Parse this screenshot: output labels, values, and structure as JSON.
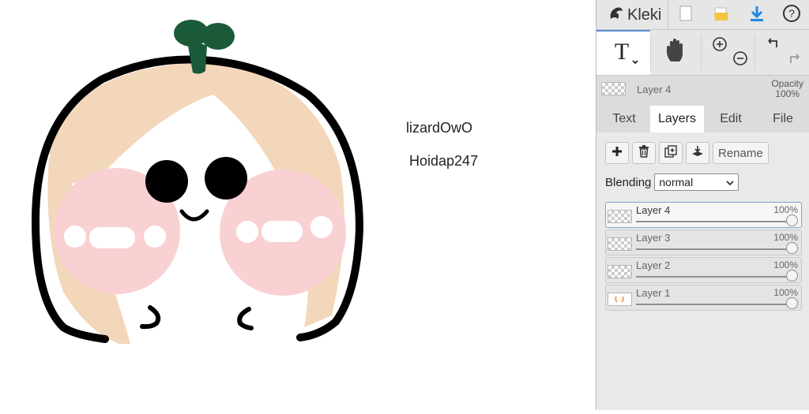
{
  "canvas": {
    "texts": [
      "lizardOwO",
      "Hoidap247"
    ]
  },
  "app": {
    "name": "Kleki"
  },
  "current_layer": {
    "name": "Layer 4",
    "opacity_label": "Opacity",
    "opacity_value": "100%"
  },
  "tabs": [
    {
      "label": "Text",
      "active": false
    },
    {
      "label": "Layers",
      "active": true
    },
    {
      "label": "Edit",
      "active": false
    },
    {
      "label": "File",
      "active": false
    }
  ],
  "layer_panel": {
    "rename_label": "Rename",
    "blending_label": "Blending",
    "blending_value": "normal",
    "layers": [
      {
        "name": "Layer 4",
        "opacity": "100%",
        "selected": true
      },
      {
        "name": "Layer 3",
        "opacity": "100%",
        "selected": false
      },
      {
        "name": "Layer 2",
        "opacity": "100%",
        "selected": false
      },
      {
        "name": "Layer 1",
        "opacity": "100%",
        "selected": false
      }
    ]
  },
  "icons": {
    "topbar": [
      "kleki-logo-icon",
      "new-image-icon",
      "open-folder-icon",
      "download-icon",
      "help-icon"
    ],
    "tools": [
      "text-tool-icon",
      "hand-tool-icon",
      "zoom-in-icon",
      "zoom-out-icon",
      "undo-icon",
      "redo-icon"
    ],
    "layer_buttons": [
      "add-layer-icon",
      "delete-layer-icon",
      "duplicate-layer-icon",
      "merge-layer-icon"
    ]
  },
  "colors": {
    "accent": "#5b8fd6",
    "download": "#1e88e5",
    "folder": "#f6c445",
    "drawing_stroke": "#000000",
    "drawing_skin": "#f3d7bb",
    "drawing_blush": "#f9d1d3",
    "drawing_leaf": "#1a5a38"
  }
}
